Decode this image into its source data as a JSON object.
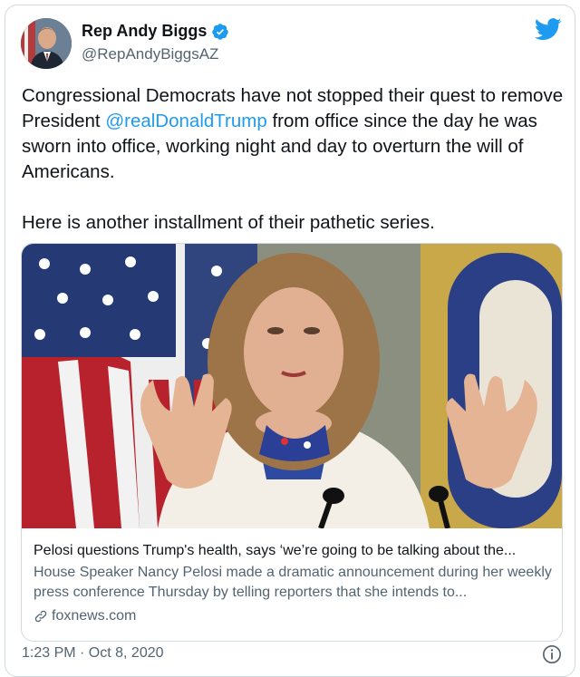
{
  "author": {
    "name": "Rep Andy Biggs",
    "handle": "@RepAndyBiggsAZ"
  },
  "tweet": {
    "text_before_mention": "Congressional Democrats have not stopped their quest to remove President ",
    "mention": "@realDonaldTrump",
    "text_after_mention": " from office since the day he was sworn into office, working night and day to overturn the will of Americans.",
    "text_paragraph_2": "Here is another installment of their pathetic series.",
    "timestamp": "1:23 PM · Oct 8, 2020"
  },
  "link_card": {
    "title": "Pelosi questions Trump's health, says ‘we’re going to be talking about the...",
    "description": "House Speaker Nancy Pelosi made a dramatic announcement during her weekly press conference Thursday by telling reporters that she intends to...",
    "domain": "foxnews.com"
  },
  "colors": {
    "accent": "#1d9bf0",
    "text": "#0f1419",
    "muted": "#536471",
    "border": "#cfd9de"
  },
  "icons": [
    "verified-badge-icon",
    "twitter-bird-icon",
    "link-icon",
    "info-icon"
  ]
}
